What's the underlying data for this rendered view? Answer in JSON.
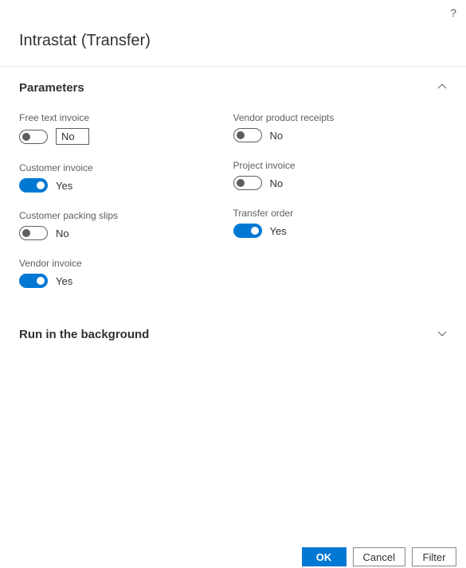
{
  "dialog": {
    "title": "Intrastat (Transfer)"
  },
  "sections": {
    "parameters": {
      "title": "Parameters"
    },
    "background": {
      "title": "Run in the background"
    }
  },
  "fields": {
    "free_text_invoice": {
      "label": "Free text invoice",
      "value": "No",
      "on": false
    },
    "customer_invoice": {
      "label": "Customer invoice",
      "value": "Yes",
      "on": true
    },
    "customer_packing_slips": {
      "label": "Customer packing slips",
      "value": "No",
      "on": false
    },
    "vendor_invoice": {
      "label": "Vendor invoice",
      "value": "Yes",
      "on": true
    },
    "vendor_product_receipts": {
      "label": "Vendor product receipts",
      "value": "No",
      "on": false
    },
    "project_invoice": {
      "label": "Project invoice",
      "value": "No",
      "on": false
    },
    "transfer_order": {
      "label": "Transfer order",
      "value": "Yes",
      "on": true
    }
  },
  "buttons": {
    "ok": "OK",
    "cancel": "Cancel",
    "filter": "Filter"
  },
  "icons": {
    "help": "?"
  }
}
